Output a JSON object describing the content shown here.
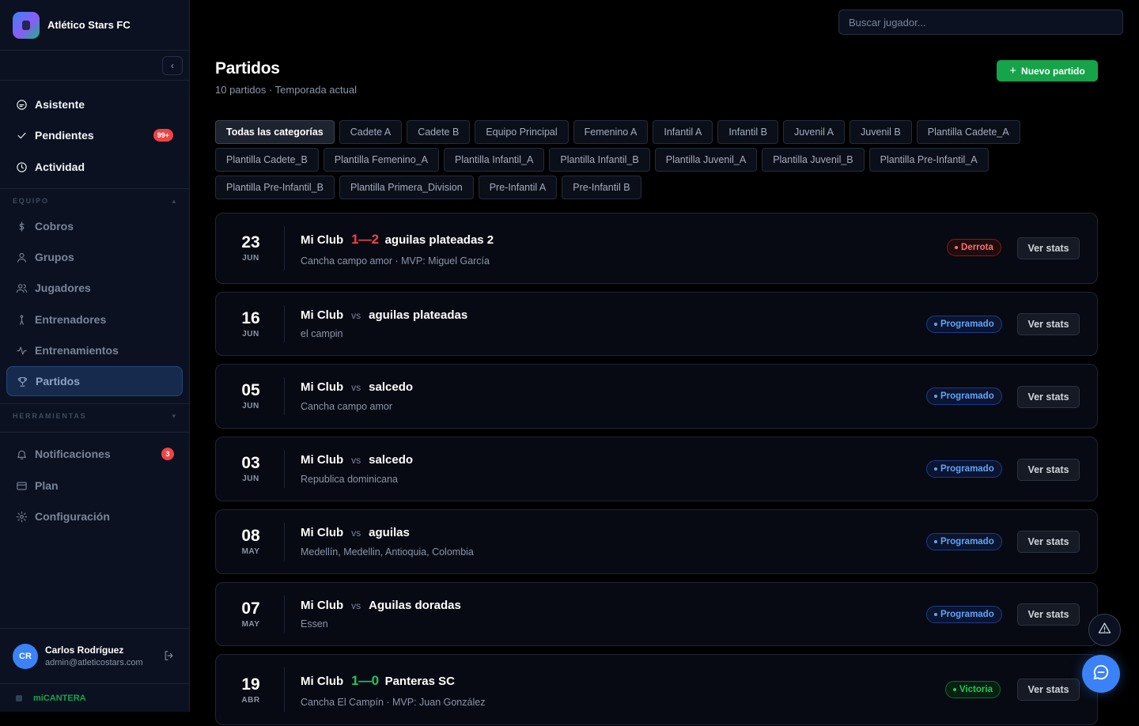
{
  "app": {
    "name": "Atlético Stars FC",
    "footer": "miCANTERA"
  },
  "sidebar": {
    "top_items": [
      {
        "label": "Asistente",
        "icon": "chat-icon"
      },
      {
        "label": "Pendientes",
        "icon": "check-icon",
        "badge": "99+"
      },
      {
        "label": "Actividad",
        "icon": "clock-icon"
      }
    ],
    "section_equipo": "EQUIPO",
    "equipo_items": [
      {
        "label": "Cobros",
        "icon": "dollar-icon"
      },
      {
        "label": "Grupos",
        "icon": "user-icon"
      },
      {
        "label": "Jugadores",
        "icon": "users-icon"
      },
      {
        "label": "Entrenadores",
        "icon": "whistle-icon"
      },
      {
        "label": "Entrenamientos",
        "icon": "activity-icon"
      },
      {
        "label": "Partidos",
        "icon": "trophy-icon",
        "active": true
      }
    ],
    "section_herramientas": "HERRAMIENTAS",
    "herramientas_items": [
      {
        "label": "Notificaciones",
        "icon": "bell-icon",
        "badge": "3"
      },
      {
        "label": "Plan",
        "icon": "card-icon"
      },
      {
        "label": "Configuración",
        "icon": "gear-icon"
      }
    ]
  },
  "user": {
    "initials": "CR",
    "name": "Carlos Rodríguez",
    "email": "admin@atleticostars.com"
  },
  "search": {
    "placeholder": "Buscar jugador..."
  },
  "page": {
    "title": "Partidos",
    "subtitle": "10 partidos · Temporada actual",
    "new_button": "Nuevo partido"
  },
  "categories": [
    "Todas las categorías",
    "Cadete A",
    "Cadete B",
    "Equipo Principal",
    "Femenino A",
    "Infantil A",
    "Infantil B",
    "Juvenil A",
    "Juvenil B",
    "Plantilla Cadete_A",
    "Plantilla Cadete_B",
    "Plantilla Femenino_A",
    "Plantilla Infantil_A",
    "Plantilla Infantil_B",
    "Plantilla Juvenil_A",
    "Plantilla Juvenil_B",
    "Plantilla Pre-Infantil_A",
    "Plantilla Pre-Infantil_B",
    "Plantilla Primera_Division",
    "Pre-Infantil A",
    "Pre-Infantil B"
  ],
  "matches": [
    {
      "day": "23",
      "month": "JUN",
      "home": "Mi Club",
      "away": "aguilas plateadas 2",
      "score": "1—2",
      "result": "loss",
      "info": "Cancha campo amor · MVP: Miguel García",
      "status": "Derrota"
    },
    {
      "day": "16",
      "month": "JUN",
      "home": "Mi Club",
      "away": "aguilas plateadas",
      "vs": "vs",
      "info": "el campin",
      "status": "Programado"
    },
    {
      "day": "05",
      "month": "JUN",
      "home": "Mi Club",
      "away": "salcedo",
      "vs": "vs",
      "info": "Cancha campo amor",
      "status": "Programado"
    },
    {
      "day": "03",
      "month": "JUN",
      "home": "Mi Club",
      "away": "salcedo",
      "vs": "vs",
      "info": "Republica dominicana",
      "status": "Programado"
    },
    {
      "day": "08",
      "month": "MAY",
      "home": "Mi Club",
      "away": "aguilas",
      "vs": "vs",
      "info": "Medellín, Medellin, Antioquia, Colombia",
      "status": "Programado"
    },
    {
      "day": "07",
      "month": "MAY",
      "home": "Mi Club",
      "away": "Aguilas doradas",
      "vs": "vs",
      "info": "Essen",
      "status": "Programado"
    },
    {
      "day": "19",
      "month": "ABR",
      "home": "Mi Club",
      "away": "Panteras SC",
      "score": "1—0",
      "result": "win",
      "info": "Cancha El Campín · MVP: Juan González",
      "status": "Victoria"
    }
  ],
  "stats_label": "Ver stats"
}
